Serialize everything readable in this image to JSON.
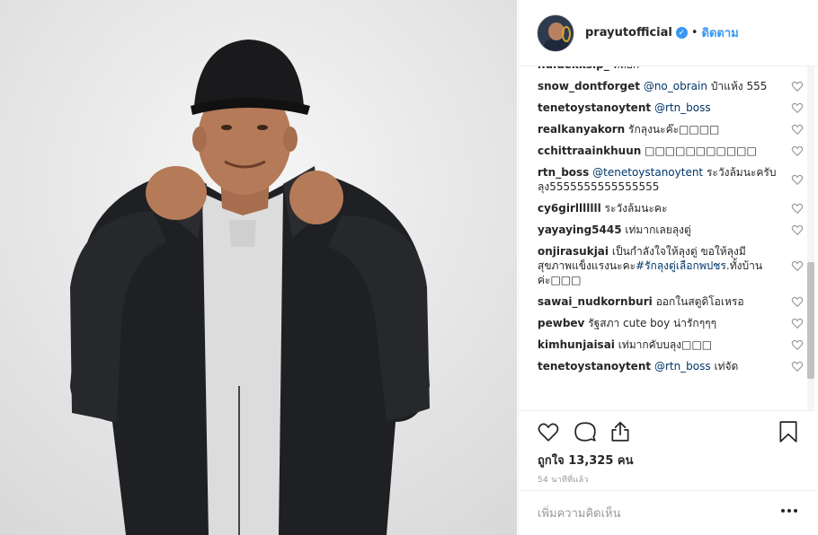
{
  "header": {
    "username": "prayutofficial",
    "verified_icon": "verified-badge-icon",
    "separator": "•",
    "follow_label": "ติดตาม"
  },
  "comments": [
    {
      "user": "nuidekksip_",
      "text": "หล่อกิ",
      "mention": "",
      "cut": true
    },
    {
      "user": "snow_dontforget",
      "mention": "@no_obrain",
      "text": "ป๋าแห้ง 555"
    },
    {
      "user": "tenetoystanoytent",
      "mention": "@rtn_boss",
      "text": ""
    },
    {
      "user": "realkanyakorn",
      "mention": "",
      "text": "รักลุงนะค๊ะ□□□□"
    },
    {
      "user": "cchittraainkhuun",
      "mention": "",
      "text": "□□□□□□□□□□□"
    },
    {
      "user": "rtn_boss",
      "mention": "@tenetoystanoytent",
      "text": "ระวังล้มนะครับลุง5555555555555555"
    },
    {
      "user": "cy6girlllllll",
      "mention": "",
      "text": "ระวังล้มนะคะ"
    },
    {
      "user": "yayaying5445",
      "mention": "",
      "text": "เท่มากเลยลุงตู่"
    },
    {
      "user": "onjirasukjai",
      "mention": "",
      "text": "เป็นกำลังใจให้ลุงตู่ ขอให้ลุงมีสุขภาพแข็งแรงนะคะ",
      "hashtag": "#รักลุงตู่เลือกพปชร.",
      "text_after": "ทั้งบ้านค่ะ□□□"
    },
    {
      "user": "sawai_nudkornburi",
      "mention": "",
      "text": "ออกในสตูดิโอเหรอ"
    },
    {
      "user": "pewbev",
      "mention": "",
      "text": "รัฐสภา cute boy น่ารักๆๆๆ"
    },
    {
      "user": "kimhunjaisai",
      "mention": "",
      "text": "เท่มากคับบลุง□□□"
    },
    {
      "user": "tenetoystanoytent",
      "mention": "@rtn_boss",
      "text": "เท่จัด"
    }
  ],
  "actions": {
    "like_icon": "heart-icon",
    "comment_icon": "comment-bubble-icon",
    "share_icon": "share-icon",
    "save_icon": "bookmark-icon",
    "likes_label": "ถูกใจ 13,325 คน",
    "time_label": "54 นาทีที่แล้ว"
  },
  "add_comment": {
    "placeholder": "เพิ่มความคิดเห็น",
    "more_icon": "more-options-icon"
  },
  "colors": {
    "link": "#003569",
    "follow": "#3897f0",
    "verified": "#3897f0",
    "muted": "#999999",
    "border": "#efefef"
  }
}
